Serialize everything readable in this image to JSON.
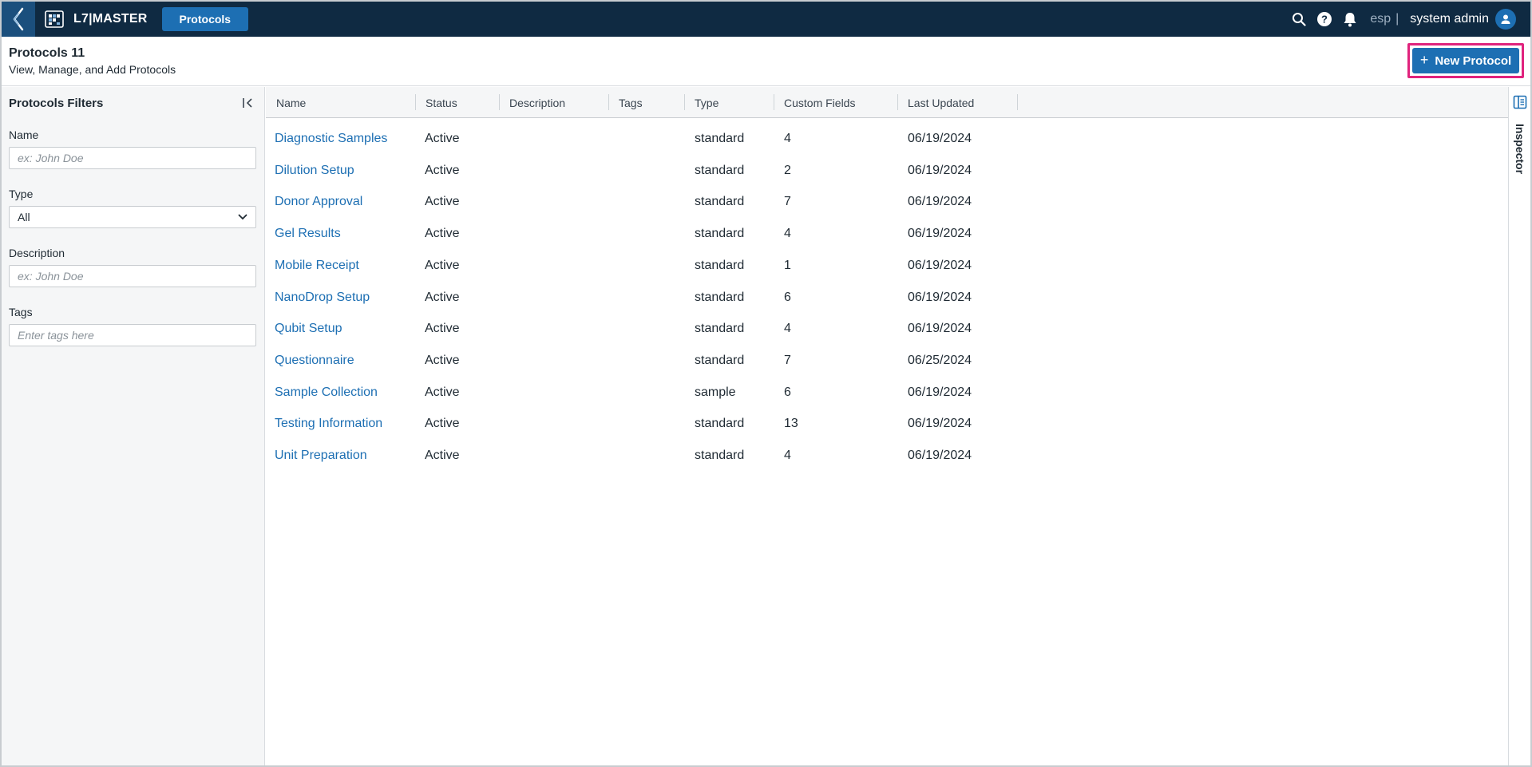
{
  "app": {
    "name": "L7|MASTER",
    "nav_tab": "Protocols"
  },
  "topbar": {
    "icons": [
      "search-icon",
      "help-icon",
      "bell-icon",
      "user-avatar-icon"
    ],
    "language": "esp",
    "separator": "|",
    "user": "system admin"
  },
  "header": {
    "title": "Protocols 11",
    "subtitle": "View, Manage, and Add Protocols",
    "new_button": "New Protocol",
    "new_button_icon": "plus-icon",
    "highlight_color": "#e0237d"
  },
  "filters": {
    "title": "Protocols Filters",
    "name_label": "Name",
    "name_placeholder": "ex: John Doe",
    "type_label": "Type",
    "type_value": "All",
    "description_label": "Description",
    "description_placeholder": "ex: John Doe",
    "tags_label": "Tags",
    "tags_placeholder": "Enter tags here"
  },
  "table": {
    "columns": [
      "Name",
      "Status",
      "Description",
      "Tags",
      "Type",
      "Custom Fields",
      "Last Updated"
    ],
    "rows": [
      {
        "name": "Diagnostic Samples",
        "status": "Active",
        "description": "",
        "tags": "",
        "type": "standard",
        "custom_fields": "4",
        "last_updated": "06/19/2024"
      },
      {
        "name": "Dilution Setup",
        "status": "Active",
        "description": "",
        "tags": "",
        "type": "standard",
        "custom_fields": "2",
        "last_updated": "06/19/2024"
      },
      {
        "name": "Donor Approval",
        "status": "Active",
        "description": "",
        "tags": "",
        "type": "standard",
        "custom_fields": "7",
        "last_updated": "06/19/2024"
      },
      {
        "name": "Gel Results",
        "status": "Active",
        "description": "",
        "tags": "",
        "type": "standard",
        "custom_fields": "4",
        "last_updated": "06/19/2024"
      },
      {
        "name": "Mobile Receipt",
        "status": "Active",
        "description": "",
        "tags": "",
        "type": "standard",
        "custom_fields": "1",
        "last_updated": "06/19/2024"
      },
      {
        "name": "NanoDrop Setup",
        "status": "Active",
        "description": "",
        "tags": "",
        "type": "standard",
        "custom_fields": "6",
        "last_updated": "06/19/2024"
      },
      {
        "name": "Qubit Setup",
        "status": "Active",
        "description": "",
        "tags": "",
        "type": "standard",
        "custom_fields": "4",
        "last_updated": "06/19/2024"
      },
      {
        "name": "Questionnaire",
        "status": "Active",
        "description": "",
        "tags": "",
        "type": "standard",
        "custom_fields": "7",
        "last_updated": "06/25/2024"
      },
      {
        "name": "Sample Collection",
        "status": "Active",
        "description": "",
        "tags": "",
        "type": "sample",
        "custom_fields": "6",
        "last_updated": "06/19/2024"
      },
      {
        "name": "Testing Information",
        "status": "Active",
        "description": "",
        "tags": "",
        "type": "standard",
        "custom_fields": "13",
        "last_updated": "06/19/2024"
      },
      {
        "name": "Unit Preparation",
        "status": "Active",
        "description": "",
        "tags": "",
        "type": "standard",
        "custom_fields": "4",
        "last_updated": "06/19/2024"
      }
    ]
  },
  "inspector": {
    "label": "Inspector",
    "icon": "inspector-panel-icon"
  },
  "colors": {
    "topbar": "#0f2a42",
    "accent": "#1d6fb3",
    "link": "#1d6fb3"
  }
}
